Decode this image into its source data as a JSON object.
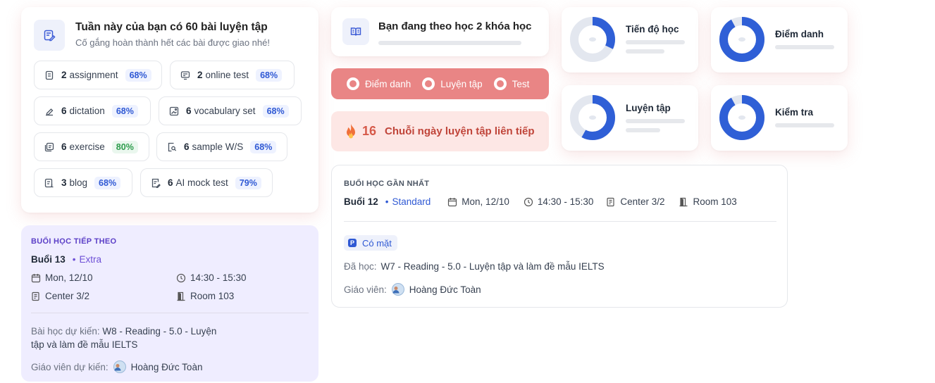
{
  "weekly": {
    "title": "Tuần này của bạn có 60 bài luyện tập",
    "subtitle": "Cố gắng hoàn thành hết các bài được giao nhé!",
    "items": [
      {
        "count": "2",
        "label": "assignment",
        "pct": "68%",
        "icon": "document-icon"
      },
      {
        "count": "2",
        "label": "online test",
        "pct": "68%",
        "icon": "monitor-icon"
      },
      {
        "count": "6",
        "label": "dictation",
        "pct": "68%",
        "icon": "pen-icon"
      },
      {
        "count": "6",
        "label": "vocabulary set",
        "pct": "68%",
        "icon": "image-icon"
      },
      {
        "count": "6",
        "label": "exercise",
        "pct": "80%",
        "icon": "stack-icon"
      },
      {
        "count": "6",
        "label": "sample W/S",
        "pct": "68%",
        "icon": "search-doc-icon"
      },
      {
        "count": "3",
        "label": "blog",
        "pct": "68%",
        "icon": "blog-icon"
      },
      {
        "count": "6",
        "label": "AI mock test",
        "pct": "79%",
        "icon": "edit-doc-icon"
      }
    ]
  },
  "next_session": {
    "section_label": "BUỔI HỌC TIẾP THEO",
    "session": "Buổi 13",
    "level": "Extra",
    "date": "Mon, 12/10",
    "time": "14:30 - 15:30",
    "center": "Center 3/2",
    "room": "Room 103",
    "lesson_label": "Bài học dự kiến:",
    "lesson_line1": "W8  - Reading - 5.0 - Luyện",
    "lesson_line2": "tập và làm đề mẫu IELTS",
    "teacher_label": "Giáo viên dự kiến:",
    "teacher": "Hoàng Đức Toàn"
  },
  "courses": {
    "text": "Bạn đang theo học 2 khóa học"
  },
  "legend": {
    "items": [
      "Điểm danh",
      "Luyện tập",
      "Test"
    ]
  },
  "streak": {
    "count": "16",
    "label": "Chuỗi ngày luyện tập liên tiếp"
  },
  "stats": [
    {
      "label": "Tiến độ học",
      "fraction": 0.32
    },
    {
      "label": "Điểm danh",
      "fraction": 0.92
    },
    {
      "label": "Luyện tập",
      "fraction": 0.58
    },
    {
      "label": "Kiểm tra",
      "fraction": 0.92
    }
  ],
  "last_session": {
    "section_label": "BUỔI HỌC GẦN NHẤT",
    "session": "Buổi 12",
    "level": "Standard",
    "date": "Mon, 12/10",
    "time": "14:30 - 15:30",
    "center": "Center 3/2",
    "room": "Room 103",
    "attendance": "Có mặt",
    "lesson_label": "Đã học:",
    "lesson": "W7 - Reading - 5.0 - Luyện tập và làm đề mẫu IELTS",
    "teacher_label": "Giáo viên:",
    "teacher": "Hoàng Đức Toàn"
  },
  "colors": {
    "accent_blue": "#2f5fd6",
    "donut_track": "#e3e7ef",
    "legend_bg": "#e98585",
    "streak_bg": "#fde7e5",
    "next_bg": "#efedff",
    "purple": "#5b3fc7"
  }
}
